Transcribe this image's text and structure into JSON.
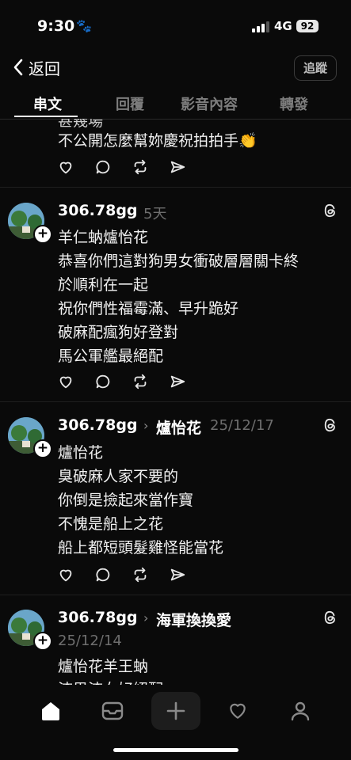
{
  "status_bar": {
    "time": "9:30",
    "network": "4G",
    "battery": "92"
  },
  "header": {
    "back_label": "返回",
    "follow_label": "追蹤"
  },
  "tabs": [
    {
      "label": "串文",
      "active": true
    },
    {
      "label": "回覆",
      "active": false
    },
    {
      "label": "影音內容",
      "active": false
    },
    {
      "label": "轉發",
      "active": false
    }
  ],
  "partial_post": {
    "cut_line": "甚幾場",
    "line": "不公開怎麼幫妳慶祝拍拍手👏"
  },
  "posts": [
    {
      "username": "306.78gg",
      "time": "5天",
      "lines": [
        "羊仁蚋爐怡花",
        "恭喜你們這對狗男女衝破層層關卡終",
        "於順利在一起",
        "祝你們性福霉滿、早升跪好",
        "破麻配瘋狗好登對",
        "馬公軍艦最絕配"
      ]
    },
    {
      "username": "306.78gg",
      "reply_to": "爐怡花",
      "time": "25/12/17",
      "lines": [
        "爐怡花",
        "臭破麻人家不要的",
        "你倒是撿起來當作寶",
        "不愧是船上之花",
        "船上都短頭髮雞怪能當花"
      ]
    },
    {
      "username": "306.78gg",
      "reply_to": "海軍換換愛",
      "time": "25/12/14",
      "lines": [
        "爐怡花羊王蚋",
        "渣男渣女好絕配"
      ]
    }
  ],
  "icons": {
    "like": "heart-icon",
    "comment": "comment-icon",
    "repost": "repost-icon",
    "share": "share-icon",
    "threads": "threads-icon",
    "home": "home-icon",
    "inbox": "inbox-icon",
    "create": "plus-icon",
    "activity": "heart-icon",
    "profile": "profile-icon"
  }
}
